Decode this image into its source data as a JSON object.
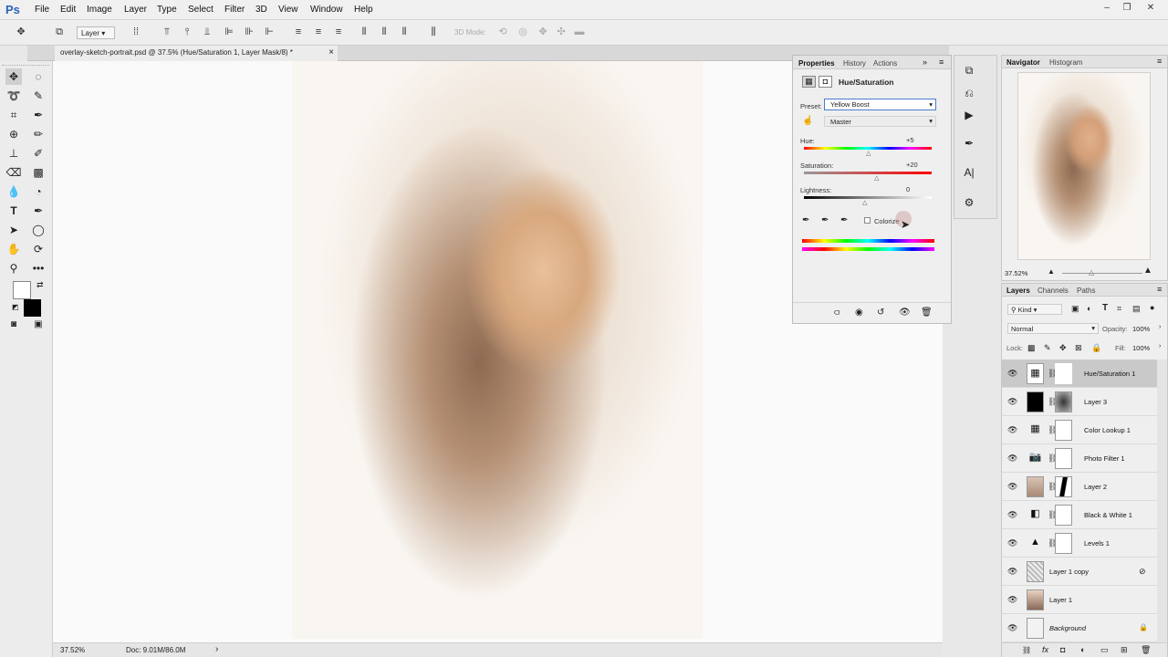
{
  "app": {
    "logo": "Ps"
  },
  "menu": [
    "File",
    "Edit",
    "Image",
    "Layer",
    "Type",
    "Select",
    "Filter",
    "3D",
    "View",
    "Window",
    "Help"
  ],
  "window_controls": [
    "–",
    "❐",
    "✕"
  ],
  "options": {
    "layer_select": "Layer",
    "mode3d": "3D Mode:"
  },
  "document": {
    "tab_title": "overlay-sketch-portrait.psd @ 37.5% (Hue/Saturation 1, Layer Mask/8) *",
    "close": "×"
  },
  "status": {
    "zoom": "37.52%",
    "doc": "Doc: 9.01M/86.0M",
    "arrow": "›"
  },
  "properties": {
    "tabs": [
      "Properties",
      "History",
      "Actions"
    ],
    "title": "Hue/Saturation",
    "preset_label": "Preset:",
    "preset_value": "Yellow Boost",
    "channel": "Master",
    "hue_label": "Hue:",
    "hue_value": "+5",
    "saturation_label": "Saturation:",
    "saturation_value": "+20",
    "lightness_label": "Lightness:",
    "lightness_value": "0",
    "colorize_label": "Colorize"
  },
  "navigator": {
    "tabs": [
      "Navigator",
      "Histogram"
    ],
    "zoom": "37.52%"
  },
  "layers_panel": {
    "tabs": [
      "Layers",
      "Channels",
      "Paths"
    ],
    "filter": "Kind",
    "blend_mode": "Normal",
    "opacity_label": "Opacity:",
    "opacity_value": "100%",
    "lock_label": "Lock:",
    "fill_label": "Fill:",
    "fill_value": "100%",
    "layers": [
      {
        "name": "Hue/Saturation 1",
        "selected": true,
        "thumb": "▦",
        "mask": "white"
      },
      {
        "name": "Layer 3",
        "selected": false,
        "thumb": "■",
        "mask": "dark"
      },
      {
        "name": "Color Lookup 1",
        "selected": false,
        "thumb": "▦",
        "mask": "white"
      },
      {
        "name": "Photo Filter 1",
        "selected": false,
        "thumb": "◉",
        "mask": "white"
      },
      {
        "name": "Layer 2",
        "selected": false,
        "thumb": "◍",
        "mask": "shape"
      },
      {
        "name": "Black & White 1",
        "selected": false,
        "thumb": "◧",
        "mask": "white"
      },
      {
        "name": "Levels 1",
        "selected": false,
        "thumb": "▲",
        "mask": "white"
      },
      {
        "name": "Layer 1 copy",
        "selected": false,
        "thumb": "▩",
        "mask": "none"
      },
      {
        "name": "Layer 1",
        "selected": false,
        "thumb": "◍",
        "mask": "none"
      },
      {
        "name": "Background",
        "selected": false,
        "thumb": "□",
        "mask": "none"
      }
    ]
  }
}
